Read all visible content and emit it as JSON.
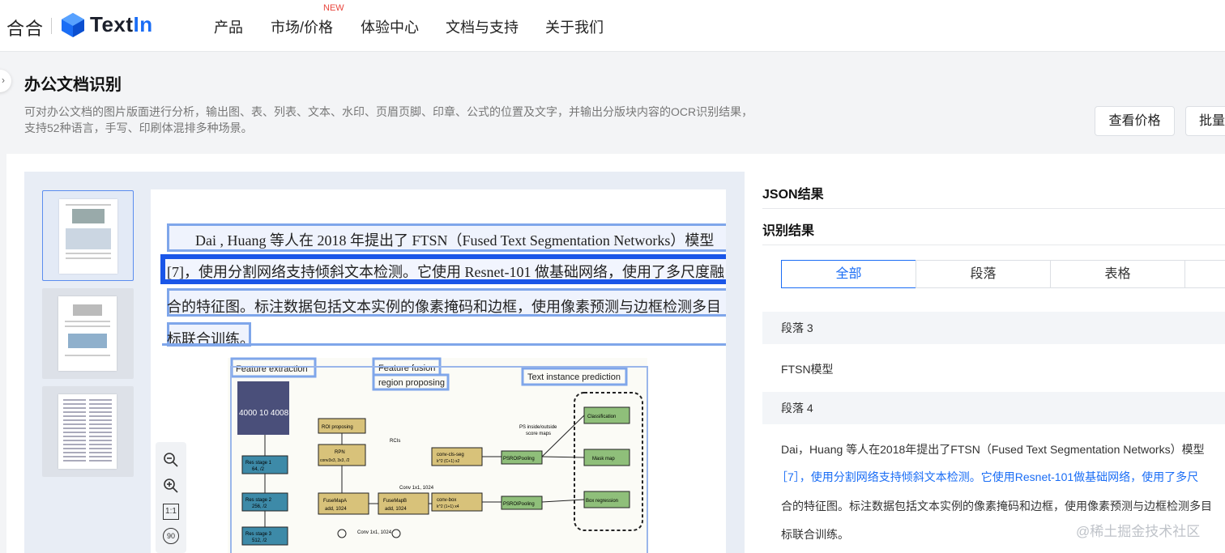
{
  "nav": {
    "hehe": "合合",
    "logo_text": "Text",
    "logo_text_in": "In",
    "items": [
      "产品",
      "市场/价格",
      "体验中心",
      "文档与支持",
      "关于我们"
    ],
    "new_badge": "NEW"
  },
  "header": {
    "title": "办公文档识别",
    "desc": "可对办公文档的图片版面进行分析，输出图、表、列表、文本、水印、页眉页脚、印章、公式的位置及文字，并输出分版块内容的OCR识别结果，支持52种语言，手写、印刷体混排多种场景。",
    "btn_price": "查看价格",
    "btn_batch": "批量"
  },
  "document": {
    "lines": [
      "Dai , Huang  等人在 2018 年提出了 FTSN（Fused Text Segmentation Networks）模型",
      "[7]，使用分割网络支持倾斜文本检测。它使用 Resnet-101 做基础网络，使用了多尺度融",
      "合的特征图。标注数据包括文本实例的像素掩码和边框，使用像素预测与边框检测多目",
      "标联合训练。"
    ],
    "diagram_labels": {
      "feature_extraction": "Feature extraction",
      "feature_fusion": "Feature fusion",
      "region_proposing": "region proposing",
      "text_instance_prediction": "Text instance prediction",
      "stamp_text": "4000 10 4008",
      "roi_proposing": "ROI proposing",
      "rpn": "RPN",
      "rpn_sub": "conv3x3, 3x3, /2",
      "rois": "RCIs",
      "res1": "Res stage 1",
      "res1_sub": "64, /2",
      "res2": "Res stage 2",
      "res2_sub": "256, /2",
      "res3": "Res stage 3",
      "res3_sub": "512, /2",
      "fusemap_a": "FuseMapA",
      "fusemap_a_sub": "add, 1024",
      "fusemap_b": "FuseMapB",
      "fusemap_b_sub": "add, 1024",
      "conv_cls": "conv-cls-seg",
      "conv_cls_sub": "k^2 (C+1) x2",
      "conv_box": "conv-box",
      "conv_box_sub": "k^2 (1+1) x4",
      "conv_1x1": "Conv 1x1, 1024",
      "conv_1x1_b": "Conv 1x1, 1024",
      "psroi1": "PSROIPooling",
      "psroi2": "PSROIPooling",
      "ps_inside": "PS inside/outside",
      "score_maps": "score maps",
      "classification": "Classification",
      "mask_map": "Mask map",
      "box_regression": "Box regression"
    }
  },
  "tools": {
    "zoom_out": "−",
    "zoom_in": "+",
    "actual": "1:1",
    "rotate": "90"
  },
  "right_panel": {
    "json_title": "JSON结果",
    "result_title": "识别结果",
    "tabs": [
      "全部",
      "段落",
      "表格"
    ],
    "paragraphs": [
      {
        "head": "段落 3",
        "text": "FTSN模型"
      },
      {
        "head": "段落 4",
        "lines": [
          "Dai，Huang 等人在2018年提出了FTSN（Fused Text Segmentation Networks）模型",
          "［7］，使用分割网络支持倾斜文本检测。它使用Resnet-101做基础网络，使用了多尺",
          "合的特征图。标注数据包括文本实例的像素掩码和边框，使用像素预测与边框检测多目",
          "标联合训练。"
        ]
      }
    ]
  },
  "watermark": "@稀土掘金技术社区",
  "colors": {
    "accent": "#1a6df5",
    "highlight": "#1a56e8",
    "badge": "#e8453c"
  }
}
